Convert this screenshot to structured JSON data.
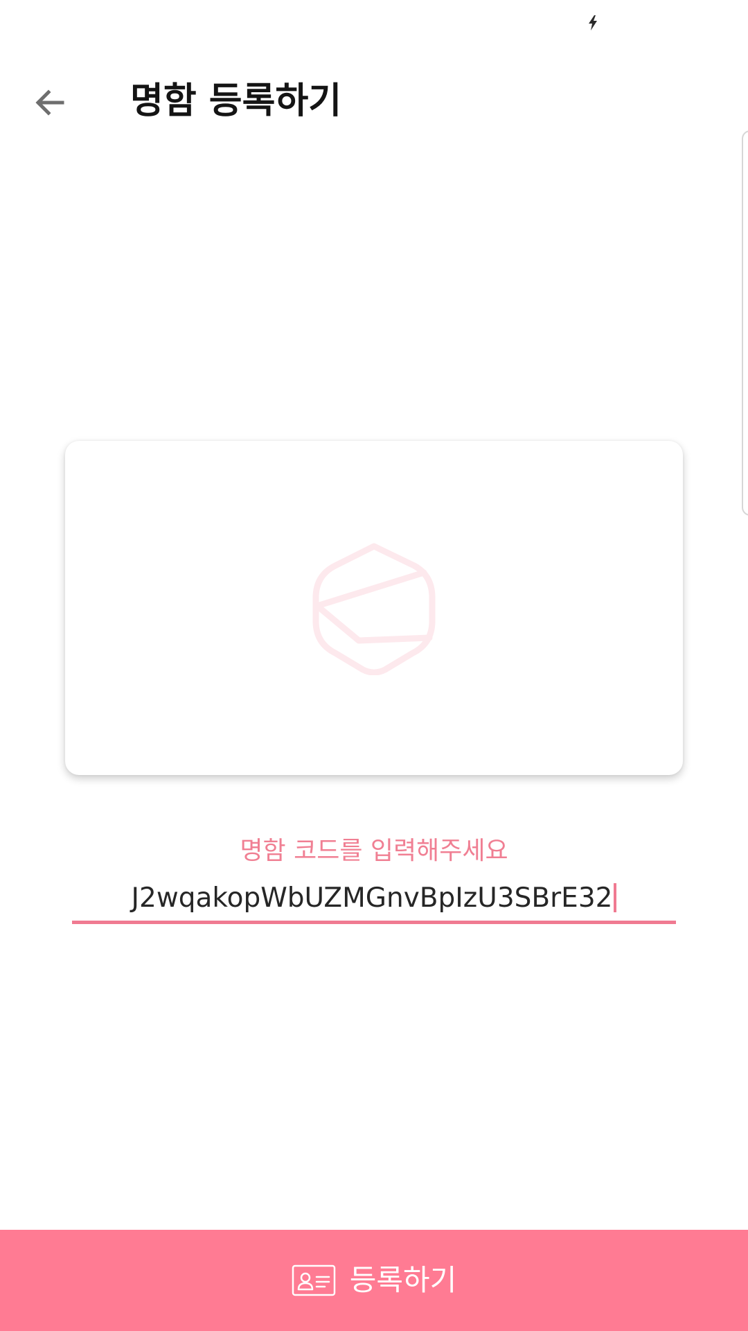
{
  "header": {
    "title": "명함 등록하기",
    "back_icon": "arrow-left-icon"
  },
  "status_bar": {
    "charging_icon": "lightning-bolt-icon"
  },
  "card_preview": {
    "logo_icon": "hexagon-envelope-logo"
  },
  "code_input": {
    "label": "명함 코드를 입력해주세요",
    "value": "J2wqakopWbUZMGnvBpIzU3SBrE32"
  },
  "submit": {
    "label": "등록하기",
    "icon": "id-card-icon"
  },
  "colors": {
    "accent": "#ff7b93",
    "label": "#f07f93",
    "logo": "#fde9ed"
  }
}
